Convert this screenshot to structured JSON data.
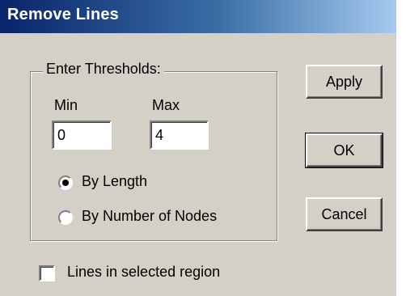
{
  "window": {
    "title": "Remove Lines"
  },
  "thresholds": {
    "legend": "Enter Thresholds:",
    "min_label": "Min",
    "min_value": "0",
    "max_label": "Max",
    "max_value": "4"
  },
  "mode": {
    "options": [
      {
        "label": "By Length",
        "selected": true
      },
      {
        "label": "By Number of Nodes",
        "selected": false
      }
    ]
  },
  "region": {
    "label": "Lines in selected region",
    "checked": false
  },
  "buttons": {
    "apply": "Apply",
    "ok": "OK",
    "cancel": "Cancel"
  },
  "colors": {
    "title_bar_start": "#0a246a",
    "title_bar_end": "#a6caf0",
    "dialog_face": "#d4d0c8"
  }
}
